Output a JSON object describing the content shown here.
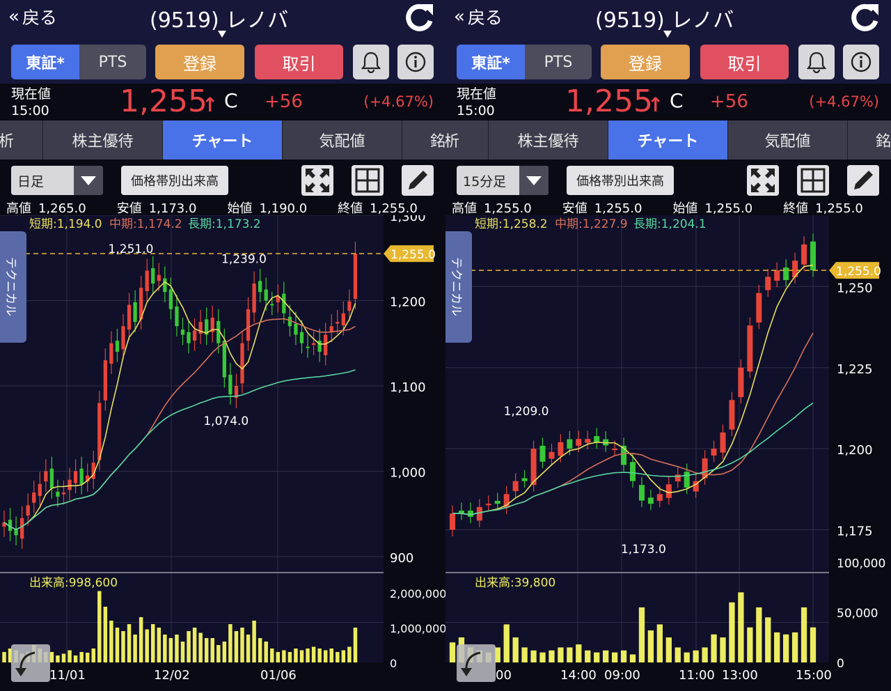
{
  "colors": {
    "up": "#e8453a",
    "down": "#38c838",
    "short_ma": "#e8e060",
    "mid_ma": "#d8705a",
    "long_ma": "#5ad8a0",
    "volume": "#ecec60",
    "last_price": "#e8b830"
  },
  "icons": {
    "refresh": "refresh-icon",
    "bell": "bell-icon",
    "info": "info-icon",
    "fullscreen": "fullscreen-icon",
    "grid": "grid-layout-icon",
    "pencil": "pencil-icon",
    "back": "double-chevron-left-icon"
  },
  "panels": [
    {
      "nav": {
        "back_label": "戻る",
        "title": "(9519) レノバ"
      },
      "market": {
        "tse": "東証*",
        "pts": "PTS"
      },
      "buttons": {
        "register": "登録",
        "trade": "取引"
      },
      "price": {
        "label": "現在値",
        "time": "15:00",
        "value": "1,255",
        "arrow": "↑",
        "flag": "C",
        "change": "+56",
        "change_pct": "(+4.67%)"
      },
      "tabs": [
        "析",
        "株主優待",
        "チャート",
        "気配値",
        "銘析"
      ],
      "active_tab": 2,
      "controls": {
        "period": "日足",
        "volume_by_price": "価格帯別出来高"
      },
      "ohlc": {
        "high_label": "高値",
        "high": "1,265.0",
        "low_label": "安値",
        "low": "1,173.0",
        "open_label": "始値",
        "open": "1,190.0",
        "close_label": "終値",
        "close": "1,255.0"
      },
      "ma_legend": {
        "short": "短期:1,194.0",
        "mid": "中期:1,174.2",
        "long": "長期:1,173.2"
      },
      "technical_label": "テクニカル",
      "volume_label": "出来高:998,600"
    },
    {
      "nav": {
        "back_label": "戻る",
        "title": "(9519) レノバ"
      },
      "market": {
        "tse": "東証*",
        "pts": "PTS"
      },
      "buttons": {
        "register": "登録",
        "trade": "取引"
      },
      "price": {
        "label": "現在値",
        "time": "15:00",
        "value": "1,255",
        "arrow": "↑",
        "flag": "C",
        "change": "+56",
        "change_pct": "(+4.67%)"
      },
      "tabs": [
        "析",
        "株主優待",
        "チャート",
        "気配値",
        "銘"
      ],
      "active_tab": 2,
      "controls": {
        "period": "15分足",
        "volume_by_price": "価格帯別出来高"
      },
      "ohlc": {
        "high_label": "高値",
        "high": "1,255.0",
        "low_label": "安値",
        "low": "1,255.0",
        "open_label": "始値",
        "open": "1,255.0",
        "close_label": "終値",
        "close": "1,255.0"
      },
      "ma_legend": {
        "short": "短期:1,258.2",
        "mid": "中期:1,227.9",
        "long": "長期:1,204.1"
      },
      "technical_label": "テクニカル",
      "volume_label": "出来高:39,800"
    }
  ],
  "chart_data": [
    {
      "type": "candlestick",
      "interval": "daily",
      "y_ticks": [
        "1,300",
        "1,200",
        "1,100",
        "1,000",
        "900"
      ],
      "y_values": [
        1300,
        1200,
        1100,
        1000,
        900
      ],
      "x_ticks": [
        "11/01",
        "12/02",
        "01/06"
      ],
      "last_price_label": "1,255.0",
      "last_price": 1255,
      "annotations": [
        {
          "text": "1,251.0",
          "value": 1251
        },
        {
          "text": "1,239.0",
          "value": 1239
        },
        {
          "text": "1,074.0",
          "value": 1074
        }
      ],
      "volume_ticks": [
        "2,000,000",
        "1,000,000",
        "0"
      ],
      "closes": [
        940,
        930,
        925,
        945,
        960,
        975,
        985,
        1000,
        980,
        970,
        975,
        990,
        1000,
        985,
        995,
        1010,
        1080,
        1130,
        1150,
        1140,
        1170,
        1195,
        1175,
        1215,
        1235,
        1220,
        1230,
        1210,
        1190,
        1170,
        1160,
        1150,
        1165,
        1175,
        1160,
        1180,
        1150,
        1110,
        1090,
        1100,
        1150,
        1190,
        1220,
        1210,
        1200,
        1195,
        1205,
        1185,
        1170,
        1160,
        1150,
        1145,
        1150,
        1140,
        1160,
        1170,
        1175,
        1185,
        1199,
        1255
      ],
      "volumes": [
        0.3,
        0.4,
        0.35,
        0.25,
        0.3,
        0.5,
        0.4,
        0.3,
        0.3,
        0.2,
        0.25,
        0.35,
        0.2,
        0.3,
        0.28,
        0.4,
        2.05,
        1.6,
        1.2,
        1.0,
        0.9,
        1.1,
        0.8,
        1.3,
        0.95,
        1.1,
        1.0,
        0.8,
        0.7,
        0.8,
        0.6,
        0.9,
        1.0,
        0.85,
        0.7,
        0.7,
        0.5,
        0.6,
        1.1,
        0.9,
        1.0,
        0.8,
        1.2,
        0.7,
        0.6,
        0.4,
        0.3,
        0.35,
        0.3,
        0.4,
        0.35,
        0.4,
        0.45,
        0.4,
        0.35,
        0.4,
        0.3,
        0.35,
        0.45,
        1.0
      ]
    },
    {
      "type": "candlestick",
      "interval": "15min",
      "y_ticks": [
        "1,250",
        "1,225",
        "1,200",
        "1,175"
      ],
      "y_values": [
        1250,
        1225,
        1200,
        1175
      ],
      "x_ticks": [
        "14:00",
        "09:00",
        "11:00",
        "13:00",
        "15:00"
      ],
      "x_tick_partial": "00",
      "last_price_label": "1,255.0",
      "last_price": 1255,
      "annotations": [
        {
          "text": "1,209.0",
          "value": 1209
        },
        {
          "text": "1,173.0",
          "value": 1173
        }
      ],
      "volume_ticks": [
        "100,000",
        "50,000",
        "0"
      ],
      "closes": [
        1180,
        1180,
        1179,
        1182,
        1183,
        1183,
        1186,
        1190,
        1190,
        1200,
        1196,
        1199,
        1202,
        1200,
        1203,
        1203,
        1202,
        1201,
        1200,
        1195,
        1190,
        1184,
        1183,
        1186,
        1189,
        1192,
        1188,
        1190,
        1197,
        1200,
        1205,
        1215,
        1225,
        1238,
        1248,
        1253,
        1255,
        1252,
        1258,
        1263,
        1255
      ],
      "volumes": [
        20,
        25,
        15,
        12,
        10,
        15,
        38,
        25,
        15,
        12,
        10,
        12,
        15,
        15,
        18,
        12,
        10,
        12,
        10,
        12,
        8,
        55,
        32,
        38,
        25,
        15,
        10,
        12,
        15,
        28,
        25,
        60,
        70,
        35,
        55,
        45,
        30,
        28,
        30,
        55,
        35
      ]
    }
  ]
}
